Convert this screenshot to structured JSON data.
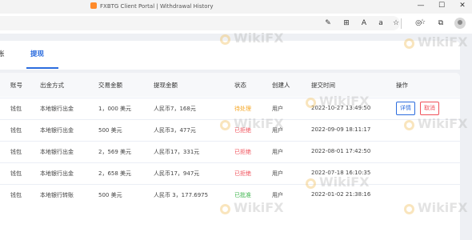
{
  "window": {
    "title": "FXBTG Client Portal | Withdrawal History"
  },
  "window_controls": {
    "minimize": "—",
    "maximize": "☐",
    "close": "✕"
  },
  "toolbar": {
    "icons": [
      "draw-icon",
      "grid-icon",
      "read-aloud-icon",
      "translate-icon",
      "favorite-add-icon",
      "tab-actions-icon",
      "favorites-icon",
      "collections-icon",
      "profile-icon"
    ],
    "glyph_draw": "✎",
    "glyph_grid": "⊞",
    "glyph_read": "A",
    "glyph_translate": "a",
    "glyph_fav_add": "☆",
    "glyph_tab": "◎",
    "glyph_favorites": "☆",
    "glyph_collections": "⧉"
  },
  "tabs": [
    {
      "label": "账"
    },
    {
      "label": "提现",
      "active": true
    }
  ],
  "table": {
    "headers": [
      "账号",
      "出金方式",
      "交易金额",
      "提现金额",
      "状态",
      "创建人",
      "提交时间",
      "操作"
    ],
    "rows": [
      {
        "account": "钱包",
        "method": "本地银行出金",
        "amount": "1，000 美元",
        "withdraw": "人民币7，168元",
        "status": "待处理",
        "status_color": "orange",
        "creator": "用户",
        "time": "2022-10-27 13:49:50",
        "actions": [
          "详情",
          "取消"
        ]
      },
      {
        "account": "钱包",
        "method": "本地银行出金",
        "amount": "500 美元",
        "withdraw": "人民币3，477元",
        "status": "已拒绝",
        "status_color": "red",
        "creator": "用户",
        "time": "2022-09-09 18:11:17",
        "actions": []
      },
      {
        "account": "钱包",
        "method": "本地银行出金",
        "amount": "2，569 美元",
        "withdraw": "人民币17，331元",
        "status": "已拒绝",
        "status_color": "red",
        "creator": "用户",
        "time": "2022-08-01 17:42:50",
        "actions": []
      },
      {
        "account": "钱包",
        "method": "本地银行出金",
        "amount": "2，658 美元",
        "withdraw": "人民币17，947元",
        "status": "已拒绝",
        "status_color": "red",
        "creator": "用户",
        "time": "2022-07-18 16:10:35",
        "actions": []
      },
      {
        "account": "钱包",
        "method": "本地银行转账",
        "amount": "500 美元",
        "withdraw": "人民币 3，177.6975",
        "status": "已批准",
        "status_color": "green",
        "creator": "用户",
        "time": "2022-01-02 21:38:16",
        "actions": []
      }
    ]
  },
  "watermark": {
    "text": "WikiFX"
  },
  "colors": {
    "accent": "#2b6cde",
    "pending": "#f5a623",
    "rejected": "#f0505a",
    "approved": "#3cb44b"
  }
}
